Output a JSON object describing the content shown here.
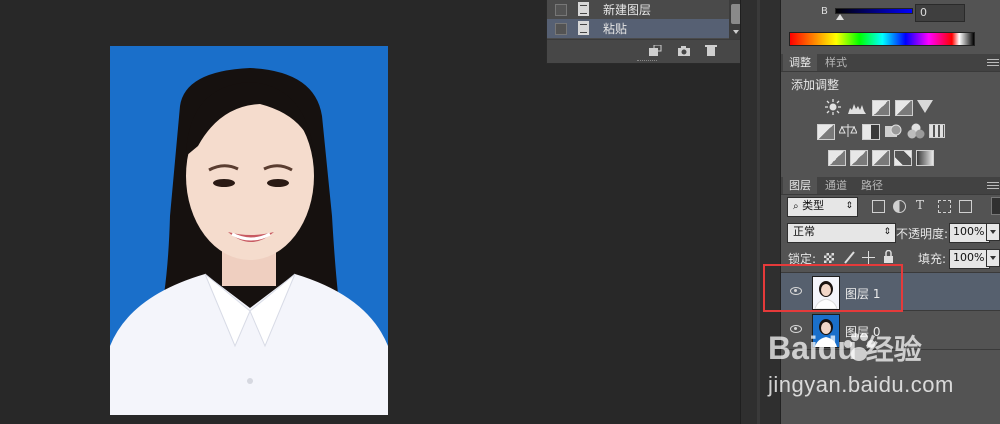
{
  "history": {
    "items": [
      {
        "label": "新建图层",
        "selected": false
      },
      {
        "label": "粘贴",
        "selected": true
      }
    ]
  },
  "color": {
    "channel_label": "B",
    "value": "0"
  },
  "adjustments": {
    "tabs": [
      "调整",
      "样式"
    ],
    "title": "添加调整",
    "icons": [
      [
        "brightness-icon",
        "levels-icon",
        "curves-icon",
        "exposure-icon",
        "vibrance-icon"
      ],
      [
        "hue-saturation-icon",
        "color-balance-icon",
        "black-white-icon",
        "photo-filter-icon",
        "channel-mixer-icon",
        "color-lookup-icon"
      ],
      [
        "invert-icon",
        "posterize-icon",
        "threshold-icon",
        "gradient-map-icon",
        "selective-color-icon"
      ]
    ]
  },
  "layers": {
    "tabs": [
      "图层",
      "通道",
      "路径"
    ],
    "filter_label": "类型",
    "blend_mode": "正常",
    "opacity_label": "不透明度:",
    "opacity_value": "100%",
    "lock_label": "锁定:",
    "fill_label": "填充:",
    "fill_value": "100%",
    "items": [
      {
        "name": "图层 1",
        "selected": true
      },
      {
        "name": "图层 0",
        "selected": false
      }
    ]
  },
  "watermark": {
    "brand": "Baidu",
    "product": "经验",
    "url": "jingyan.baidu.com"
  },
  "colors": {
    "photo_background": "#1a6fca",
    "highlight": "#e53a3a",
    "selected_layer": "#56606e",
    "selected_history": "#566073"
  }
}
